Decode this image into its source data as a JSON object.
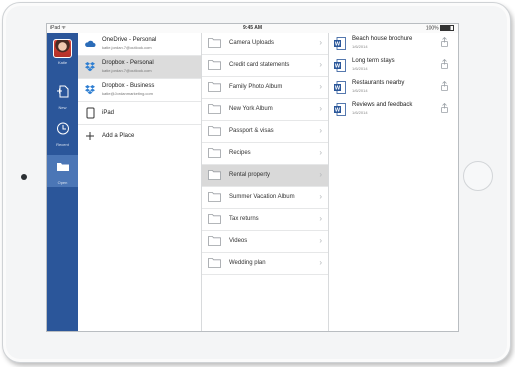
{
  "status": {
    "carrier": "iPad ᯤ",
    "time": "9:45 AM",
    "battery": "100%"
  },
  "nav": [
    {
      "label": "Katie",
      "icon": "avatar"
    },
    {
      "label": "New",
      "icon": "new-doc-icon"
    },
    {
      "label": "Recent",
      "icon": "clock-icon"
    },
    {
      "label": "Open",
      "icon": "folder-icon"
    }
  ],
  "places": [
    {
      "name": "OneDrive - Personal",
      "sub": "katie.jordan.7@outlook.com",
      "icon": "cloud-icon"
    },
    {
      "name": "Dropbox - Personal",
      "sub": "katie.jordan.7@outlook.com",
      "icon": "dropbox-icon"
    },
    {
      "name": "Dropbox - Business",
      "sub": "katie@Jordanmarketing.com",
      "icon": "dropbox-icon"
    },
    {
      "name": "iPad",
      "sub": "",
      "icon": "ipad-icon"
    },
    {
      "name": "Add a Place",
      "sub": "",
      "icon": "plus-icon"
    }
  ],
  "folders": [
    "Camera Uploads",
    "Credit card statements",
    "Family Photo Album",
    "New York Album",
    "Passport & visas",
    "Recipes",
    "Rental property",
    "Summer Vacation Album",
    "Tax returns",
    "Videos",
    "Wedding plan"
  ],
  "documents": [
    {
      "name": "Beach house brochure",
      "date": "1/6/2014"
    },
    {
      "name": "Long term stays",
      "date": "1/6/2014"
    },
    {
      "name": "Restaurants nearby",
      "date": "1/6/2014"
    },
    {
      "name": "Reviews and feedback",
      "date": "1/6/2014"
    }
  ],
  "colors": {
    "nav_bg": "#2b569a",
    "word_blue": "#2b579a",
    "dropbox_blue": "#2f7fd2",
    "selected_row": "#dcdcdc"
  }
}
